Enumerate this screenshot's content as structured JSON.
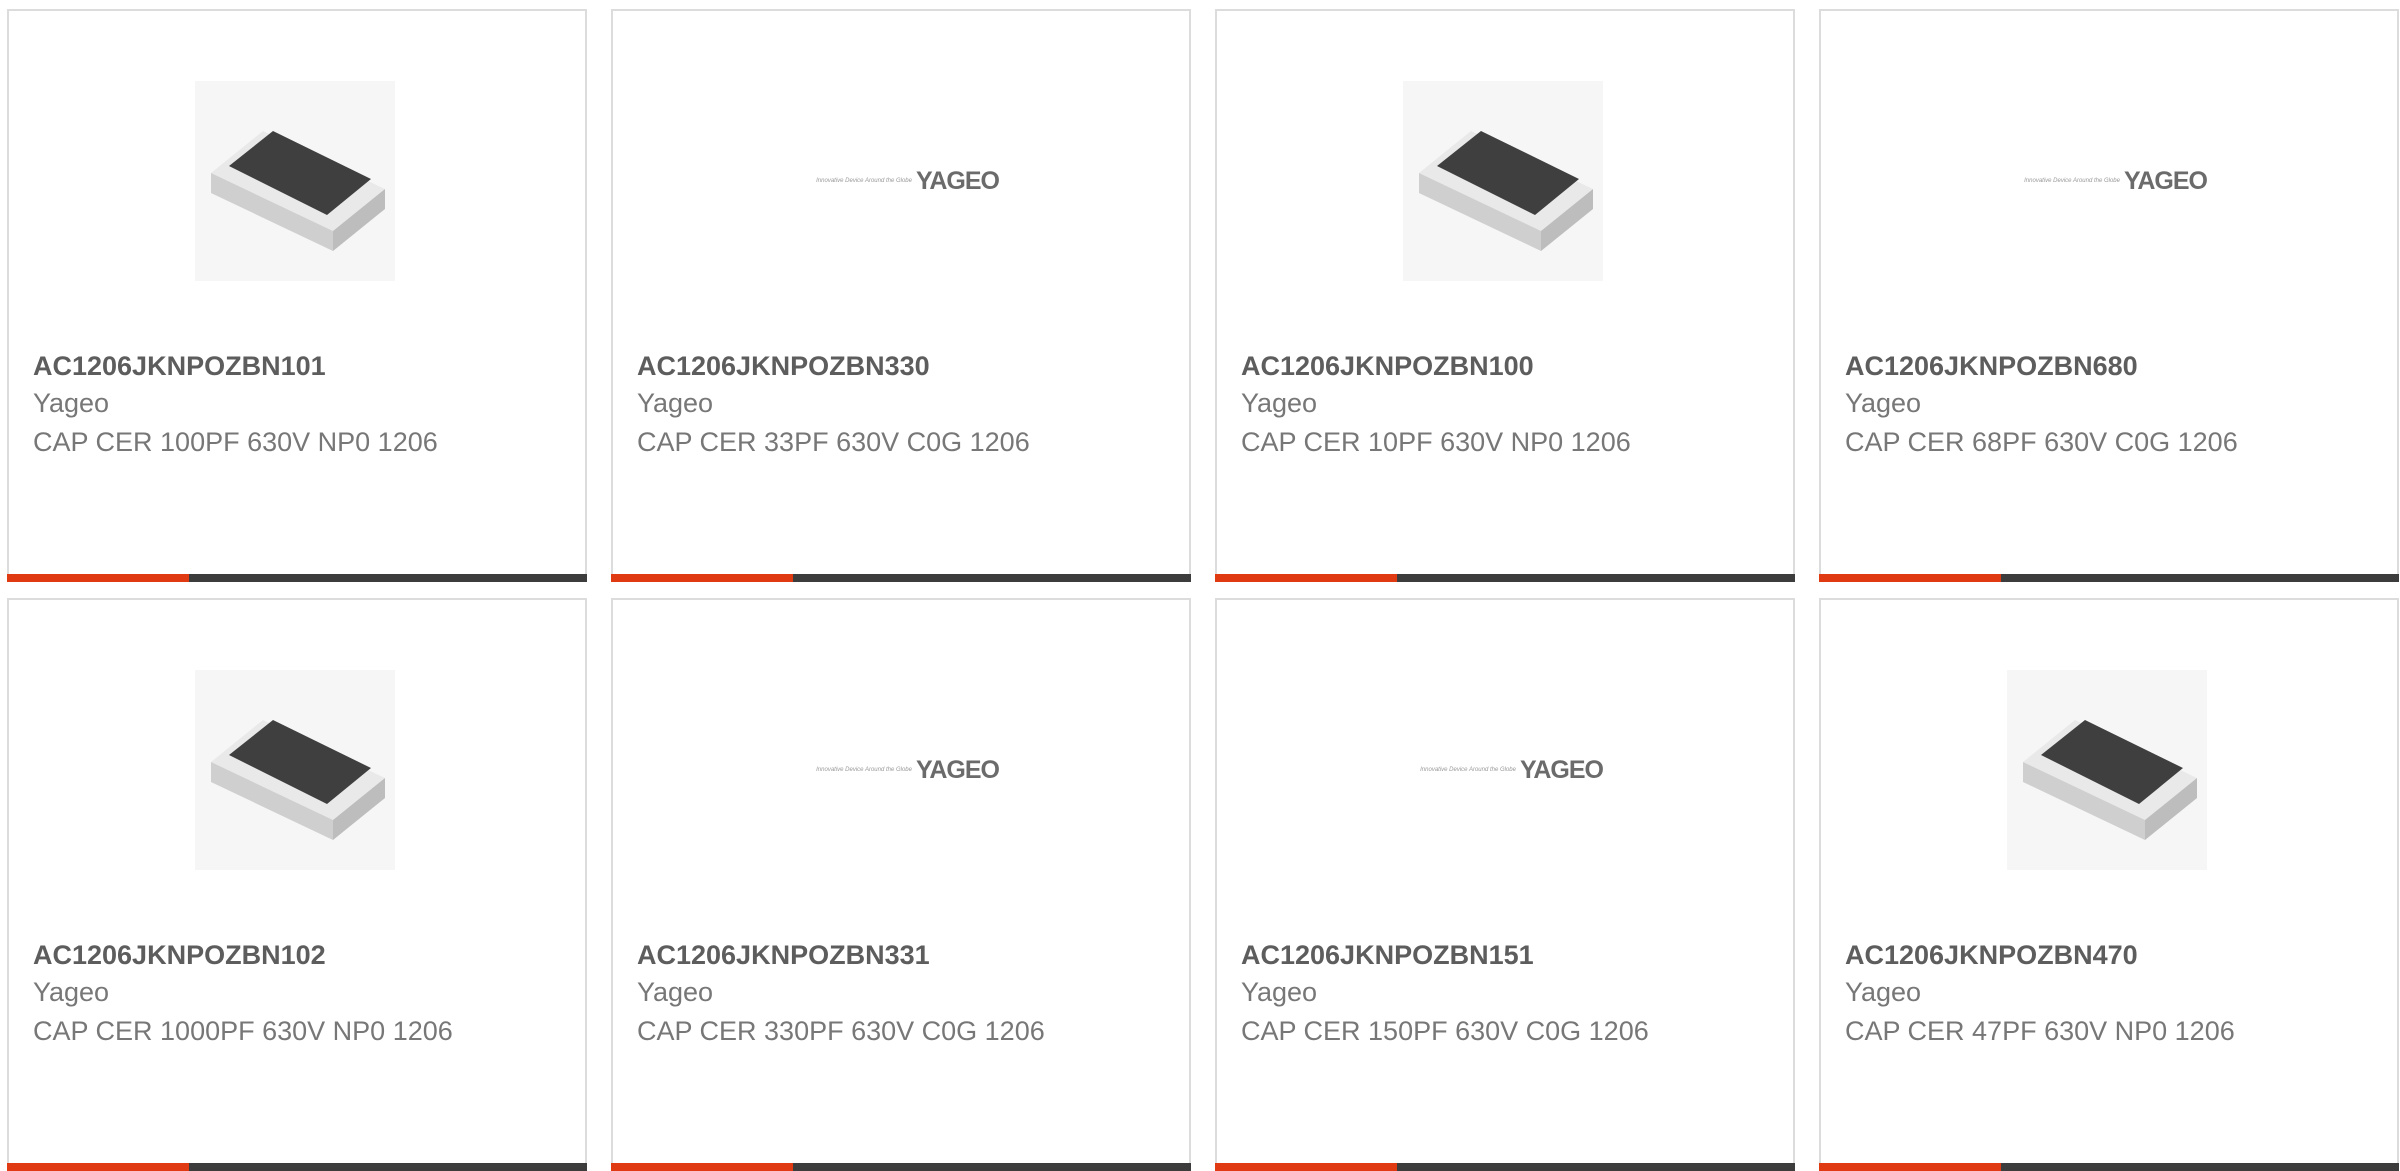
{
  "products": [
    {
      "part": "AC1206JKNPOZBN101",
      "brand": "Yageo",
      "desc": "CAP CER 100PF 630V NP0 1206",
      "image": "chip-capacitor"
    },
    {
      "part": "AC1206JKNPOZBN330",
      "brand": "Yageo",
      "desc": "CAP CER 33PF 630V C0G 1206",
      "image": "yageo-logo"
    },
    {
      "part": "AC1206JKNPOZBN100",
      "brand": "Yageo",
      "desc": "CAP CER 10PF 630V NP0 1206",
      "image": "chip-capacitor"
    },
    {
      "part": "AC1206JKNPOZBN680",
      "brand": "Yageo",
      "desc": "CAP CER 68PF 630V C0G 1206",
      "image": "yageo-logo"
    },
    {
      "part": "AC1206JKNPOZBN102",
      "brand": "Yageo",
      "desc": "CAP CER 1000PF 630V NP0 1206",
      "image": "chip-capacitor"
    },
    {
      "part": "AC1206JKNPOZBN331",
      "brand": "Yageo",
      "desc": "CAP CER 330PF 630V C0G 1206",
      "image": "yageo-logo"
    },
    {
      "part": "AC1206JKNPOZBN151",
      "brand": "Yageo",
      "desc": "CAP CER 150PF 630V C0G 1206",
      "image": "yageo-logo"
    },
    {
      "part": "AC1206JKNPOZBN470",
      "brand": "Yageo",
      "desc": "CAP CER 47PF 630V NP0 1206",
      "image": "chip-capacitor"
    }
  ],
  "logo": {
    "tagline": "Innovative Device Around the Globe",
    "word": "YAGEO"
  },
  "colors": {
    "accent": "#e03a12",
    "bar": "#3c3c3c",
    "border": "#dcdcdc",
    "part_text": "#5d5d5d",
    "body_text": "#777777"
  }
}
